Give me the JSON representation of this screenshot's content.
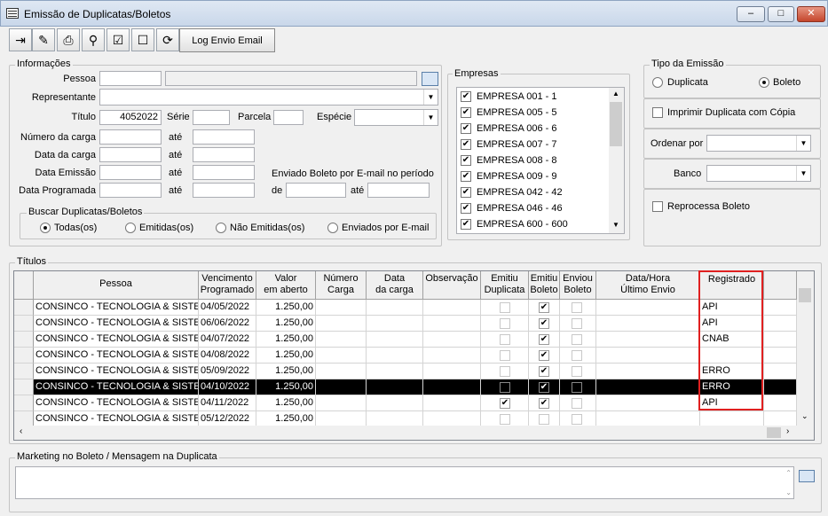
{
  "window": {
    "title": "Emissão de Duplicatas/Boletos"
  },
  "toolbar": {
    "log_label": "Log Envio Email"
  },
  "info": {
    "legend": "Informações",
    "pessoa": "Pessoa",
    "representante": "Representante",
    "titulo": "Título",
    "titulo_value": "4052022",
    "serie": "Série",
    "parcela": "Parcela",
    "especie": "Espécie",
    "numero_carga": "Número da carga",
    "data_carga": "Data da carga",
    "data_emissao": "Data Emissão",
    "data_programada": "Data Programada",
    "ate": "até",
    "enviado_label": "Enviado Boleto por E-mail no período",
    "de": "de"
  },
  "buscar": {
    "legend": "Buscar Duplicatas/Boletos",
    "options": [
      "Todas(os)",
      "Emitidas(os)",
      "Não Emitidas(os)",
      "Enviados por E-mail"
    ],
    "selected": 0
  },
  "empresas": {
    "legend": "Empresas",
    "items": [
      "EMPRESA 001 - 1",
      "EMPRESA 005 - 5",
      "EMPRESA 006 - 6",
      "EMPRESA 007 - 7",
      "EMPRESA 008 - 8",
      "EMPRESA 009 - 9",
      "EMPRESA 042 - 42",
      "EMPRESA 046 - 46",
      "EMPRESA 600 - 600"
    ]
  },
  "tipo": {
    "legend": "Tipo da Emissão",
    "duplicata": "Duplicata",
    "boleto": "Boleto",
    "selected": "Boleto",
    "imprimir": "Imprimir Duplicata com Cópia",
    "ordenar": "Ordenar por",
    "banco": "Banco",
    "reprocessa": "Reprocessa Boleto"
  },
  "titulos": {
    "legend": "Títulos",
    "headers": [
      "Pessoa",
      "Vencimento\nProgramado",
      "Valor\nem aberto",
      "Número\nCarga",
      "Data\nda carga",
      "Observação",
      "Emitiu\nDuplicata",
      "Emitiu\nBoleto",
      "Enviou\nBoleto",
      "Data/Hora\nÚltimo Envio",
      "Registrado"
    ],
    "rows": [
      {
        "pessoa": "CONSINCO - TECNOLOGIA & SISTEMAS",
        "venc": "04/05/2022",
        "valor": "1.250,00",
        "dup": false,
        "bol": true,
        "env": false,
        "reg": "API"
      },
      {
        "pessoa": "CONSINCO - TECNOLOGIA & SISTEMAS",
        "venc": "06/06/2022",
        "valor": "1.250,00",
        "dup": false,
        "bol": true,
        "env": false,
        "reg": "API"
      },
      {
        "pessoa": "CONSINCO - TECNOLOGIA & SISTEMAS",
        "venc": "04/07/2022",
        "valor": "1.250,00",
        "dup": false,
        "bol": true,
        "env": false,
        "reg": "CNAB"
      },
      {
        "pessoa": "CONSINCO - TECNOLOGIA & SISTEMAS",
        "venc": "04/08/2022",
        "valor": "1.250,00",
        "dup": false,
        "bol": true,
        "env": false,
        "reg": ""
      },
      {
        "pessoa": "CONSINCO - TECNOLOGIA & SISTEMAS",
        "venc": "05/09/2022",
        "valor": "1.250,00",
        "dup": false,
        "bol": true,
        "env": false,
        "reg": "ERRO"
      },
      {
        "pessoa": "CONSINCO - TECNOLOGIA & SISTEMAS",
        "venc": "04/10/2022",
        "valor": "1.250,00",
        "dup": false,
        "bol": true,
        "env": false,
        "reg": "ERRO",
        "selected": true
      },
      {
        "pessoa": "CONSINCO - TECNOLOGIA & SISTEMAS",
        "venc": "04/11/2022",
        "valor": "1.250,00",
        "dup": true,
        "bol": true,
        "env": false,
        "reg": "API"
      },
      {
        "pessoa": "CONSINCO - TECNOLOGIA & SISTEMAS",
        "venc": "05/12/2022",
        "valor": "1.250,00",
        "dup": false,
        "bol": false,
        "env": false,
        "reg": ""
      }
    ]
  },
  "marketing": {
    "legend": "Marketing no Boleto / Mensagem na Duplicata"
  },
  "colors": {
    "highlight": "#e02020",
    "selected_row": "#000000"
  }
}
